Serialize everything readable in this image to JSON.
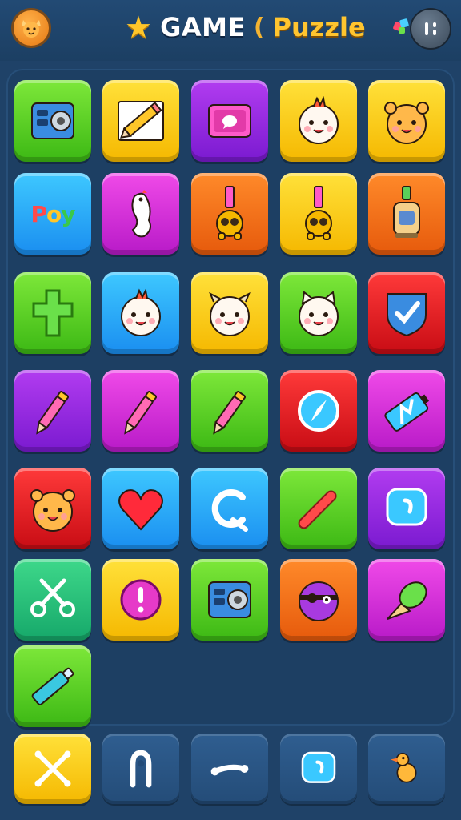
{
  "header": {
    "title_main": "GAME",
    "title_separator": "(",
    "title_sub": "Puzzle",
    "left_button_icon": "fox-avatar-icon",
    "right_button_icon": "menu-icon",
    "star_icon": "star-icon"
  },
  "colors": {
    "background": "#1f4268",
    "title_accent": "#ffc52f",
    "green": "#3cb814",
    "yellow": "#f5b800",
    "purple": "#7a1ad0",
    "blue": "#1a8ef0",
    "magenta": "#b81ac8",
    "orange": "#e65a0c",
    "red": "#c80c14",
    "teal": "#16a86a"
  },
  "board": {
    "rows": [
      [
        {
          "color": "green",
          "icon": "speaker-box-icon"
        },
        {
          "color": "yellow",
          "icon": "pencil-paper-icon"
        },
        {
          "color": "purple",
          "icon": "chat-screen-icon"
        },
        {
          "color": "yellow",
          "icon": "chick-face-icon"
        },
        {
          "color": "yellow",
          "icon": "bear-face-icon"
        }
      ],
      [
        {
          "color": "blue",
          "icon": "poy-text-icon",
          "text": "Poy"
        },
        {
          "color": "magenta",
          "icon": "ghost-bird-icon"
        },
        {
          "color": "orange",
          "icon": "robot-plunger-icon"
        },
        {
          "color": "yellow",
          "icon": "robot-plunger-icon"
        },
        {
          "color": "orange",
          "icon": "lantern-robot-icon"
        }
      ],
      [
        {
          "color": "green",
          "icon": "cross-icon"
        },
        {
          "color": "blue",
          "icon": "chick-face-icon"
        },
        {
          "color": "yellow",
          "icon": "cow-face-icon"
        },
        {
          "color": "green",
          "icon": "cat-face-icon"
        },
        {
          "color": "red",
          "icon": "shield-check-icon"
        }
      ],
      [
        {
          "color": "purple",
          "icon": "pencil-icon"
        },
        {
          "color": "magenta",
          "icon": "pencil-icon"
        },
        {
          "color": "green",
          "icon": "pencil-icon"
        },
        {
          "color": "red",
          "icon": "compass-icon"
        },
        {
          "color": "magenta",
          "icon": "battery-tag-icon"
        }
      ],
      [
        {
          "color": "red",
          "icon": "bear-face-icon"
        },
        {
          "color": "blue",
          "icon": "heart-icon"
        },
        {
          "color": "blue",
          "icon": "letter-c-icon"
        },
        {
          "color": "green",
          "icon": "marker-icon"
        },
        {
          "color": "purple",
          "icon": "speech-bubble-icon"
        }
      ],
      [
        {
          "color": "teal",
          "icon": "scissors-icon"
        },
        {
          "color": "yellow",
          "icon": "alert-circle-icon"
        },
        {
          "color": "green",
          "icon": "speaker-box-icon"
        },
        {
          "color": "orange",
          "icon": "pirate-ball-icon"
        },
        {
          "color": "magenta",
          "icon": "ice-cream-cone-icon"
        }
      ],
      [
        {
          "color": "green",
          "icon": "glue-tube-icon"
        }
      ]
    ]
  },
  "tray": {
    "items": [
      {
        "color": "yellow",
        "icon": "crossed-bones-icon"
      },
      {
        "color": "navy",
        "icon": "ghost-loop-icon"
      },
      {
        "color": "navy",
        "icon": "bone-icon"
      },
      {
        "color": "navy",
        "icon": "speech-bubble-icon"
      },
      {
        "color": "navy",
        "icon": "duck-icon"
      }
    ]
  }
}
